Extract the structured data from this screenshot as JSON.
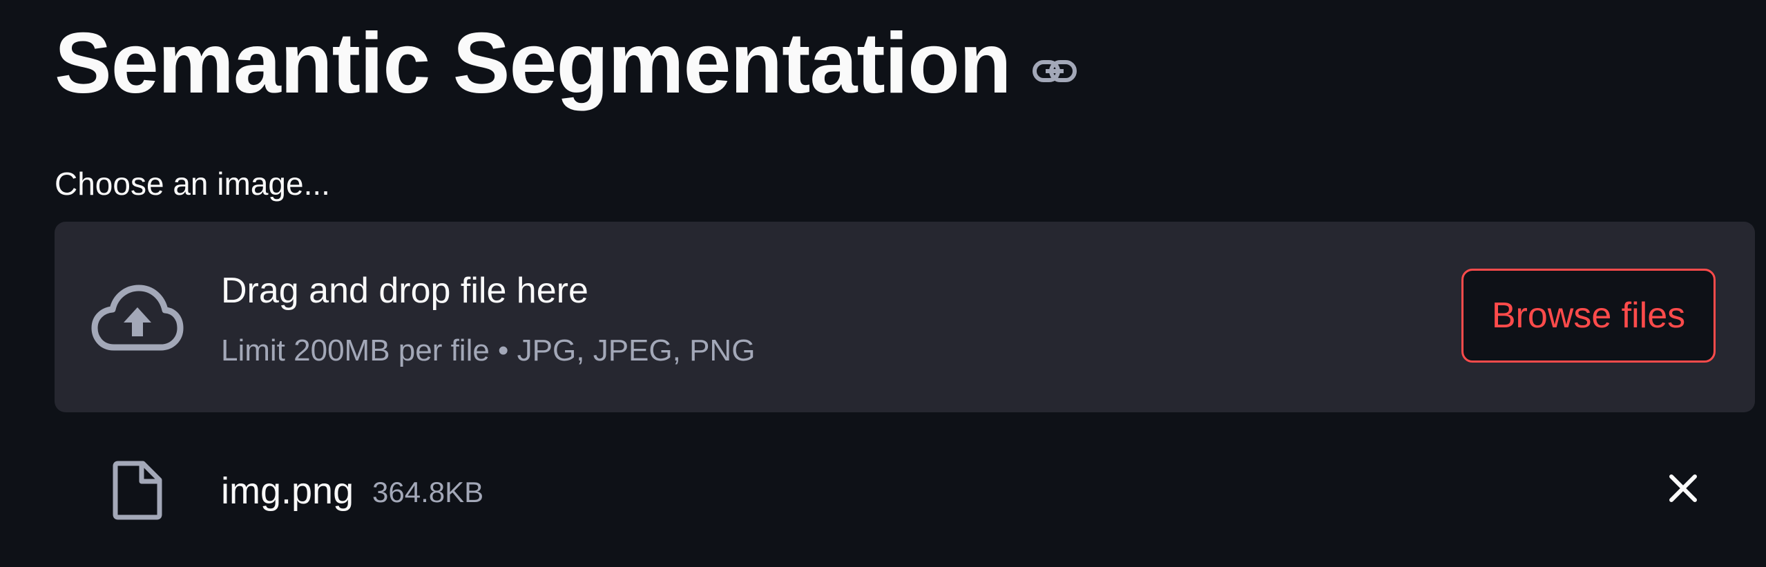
{
  "header": {
    "title": "Semantic Segmentation",
    "anchor_icon": "link-icon"
  },
  "uploader": {
    "label": "Choose an image...",
    "drop_text": "Drag and drop file here",
    "limit_text": "Limit 200MB per file • JPG, JPEG, PNG",
    "browse_label": "Browse files",
    "upload_icon": "cloud-upload-icon"
  },
  "uploaded_file": {
    "name": "img.png",
    "size": "364.8KB",
    "file_icon": "file-icon",
    "remove_icon": "close-icon"
  },
  "colors": {
    "background": "#0e1117",
    "dropzone": "#262730",
    "accent": "#ff4b4b",
    "text": "#fafafa",
    "muted_text": "#a3a8b8"
  }
}
